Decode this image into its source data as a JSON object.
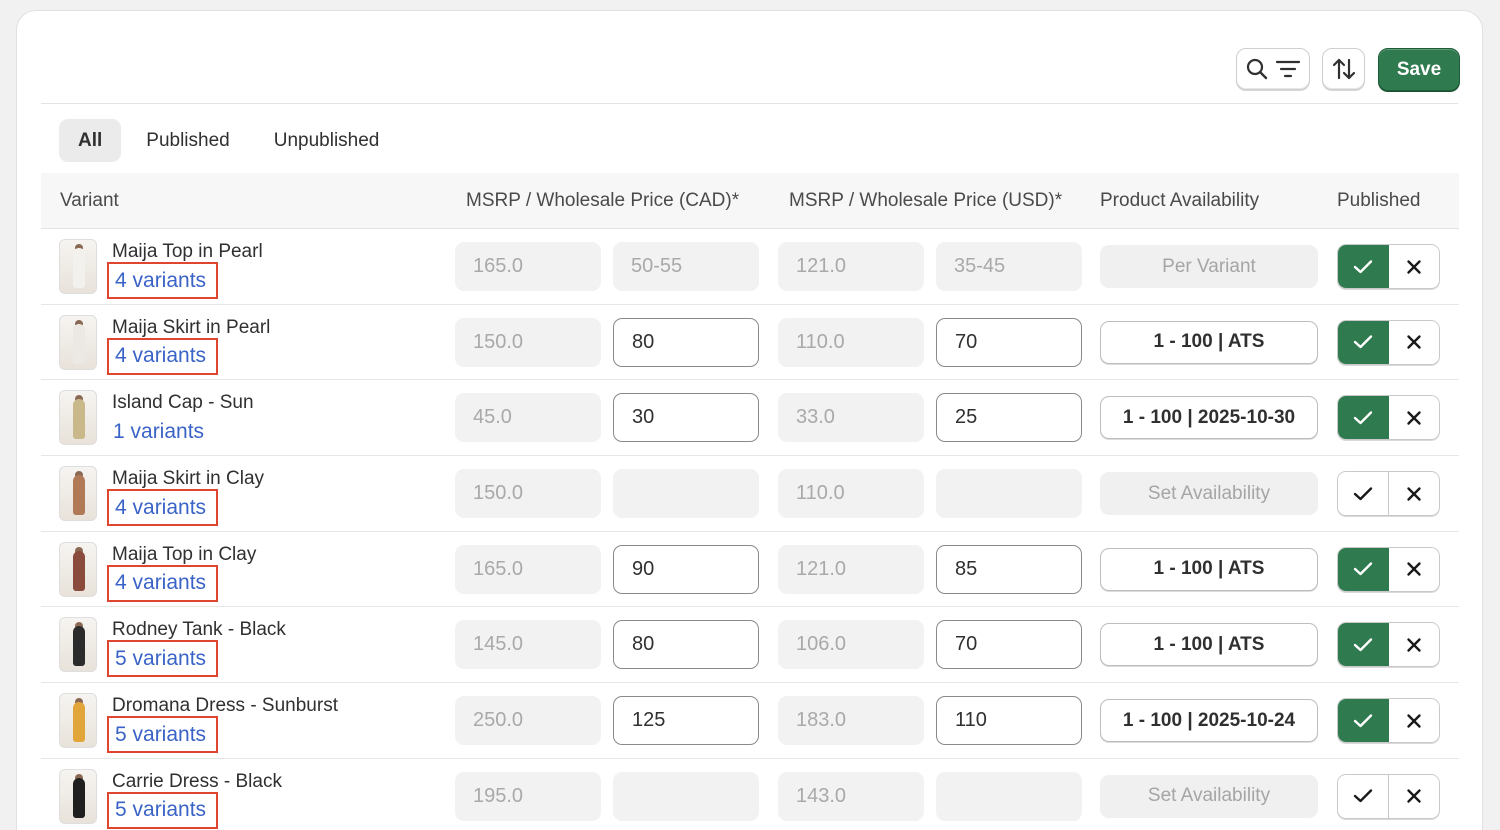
{
  "toolbar": {
    "save_label": "Save",
    "search_icon": "search-icon",
    "filter_icon": "filter-icon",
    "sort_icon": "sort-icon"
  },
  "tabs": [
    {
      "label": "All",
      "active": true
    },
    {
      "label": "Published",
      "active": false
    },
    {
      "label": "Unpublished",
      "active": false
    }
  ],
  "table": {
    "headers": {
      "variant": "Variant",
      "msrp_cad": "MSRP / Wholesale Price (CAD)*",
      "msrp_usd": "MSRP / Wholesale Price (USD)*",
      "availability": "Product Availability",
      "published": "Published"
    },
    "rows": [
      {
        "name": "Maija Top in Pearl",
        "variants": "4 variants",
        "msrp_cad": "165.0",
        "wholesale_cad": "50-55",
        "wholesale_cad_editable": false,
        "msrp_usd": "121.0",
        "wholesale_usd": "35-45",
        "wholesale_usd_editable": false,
        "availability": "Per Variant",
        "availability_set": false,
        "published": true,
        "highlight": true,
        "thumb_color": "#f3f1ee"
      },
      {
        "name": "Maija Skirt in Pearl",
        "variants": "4 variants",
        "msrp_cad": "150.0",
        "wholesale_cad": "80",
        "wholesale_cad_editable": true,
        "msrp_usd": "110.0",
        "wholesale_usd": "70",
        "wholesale_usd_editable": true,
        "availability": "1 - 100 | ATS",
        "availability_set": true,
        "published": true,
        "highlight": true,
        "thumb_color": "#ece9e4"
      },
      {
        "name": "Island Cap - Sun",
        "variants": "1 variants",
        "msrp_cad": "45.0",
        "wholesale_cad": "30",
        "wholesale_cad_editable": true,
        "msrp_usd": "33.0",
        "wholesale_usd": "25",
        "wholesale_usd_editable": true,
        "availability": "1 - 100 | 2025-10-30",
        "availability_set": true,
        "published": true,
        "highlight": false,
        "thumb_color": "#c9b98a"
      },
      {
        "name": "Maija Skirt in Clay",
        "variants": "4 variants",
        "msrp_cad": "150.0",
        "wholesale_cad": "",
        "wholesale_cad_editable": false,
        "msrp_usd": "110.0",
        "wholesale_usd": "",
        "wholesale_usd_editable": false,
        "availability": "Set Availability",
        "availability_set": false,
        "published": false,
        "highlight": true,
        "thumb_color": "#b07a56"
      },
      {
        "name": "Maija Top in Clay",
        "variants": "4 variants",
        "msrp_cad": "165.0",
        "wholesale_cad": "90",
        "wholesale_cad_editable": true,
        "msrp_usd": "121.0",
        "wholesale_usd": "85",
        "wholesale_usd_editable": true,
        "availability": "1 - 100 | ATS",
        "availability_set": true,
        "published": true,
        "highlight": true,
        "thumb_color": "#8a4a3c"
      },
      {
        "name": "Rodney Tank - Black",
        "variants": "5 variants",
        "msrp_cad": "145.0",
        "wholesale_cad": "80",
        "wholesale_cad_editable": true,
        "msrp_usd": "106.0",
        "wholesale_usd": "70",
        "wholesale_usd_editable": true,
        "availability": "1 - 100 | ATS",
        "availability_set": true,
        "published": true,
        "highlight": true,
        "thumb_color": "#2b2b2b"
      },
      {
        "name": "Dromana Dress - Sunburst",
        "variants": "5 variants",
        "msrp_cad": "250.0",
        "wholesale_cad": "125",
        "wholesale_cad_editable": true,
        "msrp_usd": "183.0",
        "wholesale_usd": "110",
        "wholesale_usd_editable": true,
        "availability": "1 - 100 | 2025-10-24",
        "availability_set": true,
        "published": true,
        "highlight": true,
        "thumb_color": "#e2a53a"
      },
      {
        "name": "Carrie Dress - Black",
        "variants": "5 variants",
        "msrp_cad": "195.0",
        "wholesale_cad": "",
        "wholesale_cad_editable": false,
        "msrp_usd": "143.0",
        "wholesale_usd": "",
        "wholesale_usd_editable": false,
        "availability": "Set Availability",
        "availability_set": false,
        "published": false,
        "highlight": true,
        "thumb_color": "#1f1f1f"
      }
    ]
  },
  "colors": {
    "accent_green": "#2f7a4f",
    "link_blue": "#3a63c7",
    "highlight_red": "#e0452f"
  }
}
